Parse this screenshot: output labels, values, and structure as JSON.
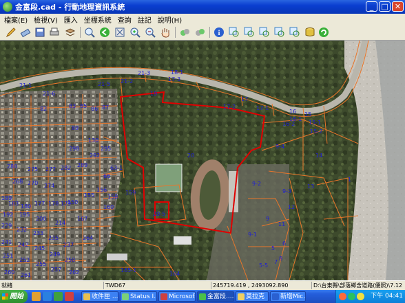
{
  "window": {
    "title": "金富段.cad - 行動地理資訊系統"
  },
  "menu": [
    "檔案(E)",
    "檢視(V)",
    "匯入",
    "坐標系統",
    "查詢",
    "註記",
    "說明(H)"
  ],
  "toolbar_icons": [
    "pencil-icon",
    "eraser-icon",
    "save-icon",
    "print-icon",
    "layers-icon",
    "zoom-window-icon",
    "back-icon",
    "full-extent-icon",
    "zoom-in-icon",
    "zoom-out-icon",
    "pan-icon",
    "query-icon",
    "query2-icon",
    "info-icon",
    "select-window-icon",
    "select-window2-icon",
    "select-window3-icon",
    "select-window4-icon",
    "select-window5-icon",
    "database-icon",
    "refresh-icon"
  ],
  "parcel_labels": [
    "21-3",
    "18-1",
    "17-3",
    "19",
    "21-2",
    "21-5",
    "21-1",
    "21-6",
    "17-2",
    "17",
    "17-1",
    "16",
    "15",
    "16-1",
    "16-2",
    "15-1",
    "15-2",
    "14",
    "9-4",
    "9-2",
    "9-3",
    "9-1",
    "9",
    "11",
    "12",
    "13",
    "1",
    "5-5",
    "5",
    "6",
    "8",
    "7",
    "20",
    "20-5",
    "165-1",
    "164",
    "63-1",
    "159",
    "66",
    "82",
    "83",
    "85",
    "86",
    "87",
    "89",
    "130",
    "150",
    "155",
    "156",
    "158",
    "160",
    "167",
    "177",
    "178",
    "179",
    "180",
    "183",
    "189",
    "192",
    "195",
    "200",
    "214",
    "229",
    "232",
    "233",
    "235",
    "237",
    "241",
    "242",
    "245",
    "249",
    "250",
    "251",
    "252",
    "255",
    "257",
    "260",
    "261",
    "262",
    "264",
    "268",
    "270",
    "274",
    "275",
    "277",
    "280",
    "282",
    "289",
    "292",
    "295",
    "298"
  ],
  "status": {
    "state": "就緒",
    "coord_system": "TWD67",
    "coordinates": "245719.419 , 2493092.890",
    "file_path": "D:\\台東縣\\部落鄉舍道路(優照)\\7.12"
  },
  "taskbar": {
    "start": "開始",
    "tasks": [
      "收件匣 ...",
      "Status I...",
      "Microsof...",
      "金富段....",
      "莫拉克",
      "新增Mic..."
    ],
    "active_index": 3,
    "clock": "下午 04:41"
  },
  "colors": {
    "parcel_line": "#e8762a",
    "selected_parcel": "#e00000",
    "label": "#2020d0",
    "titlebar": "#0a3ed0"
  }
}
